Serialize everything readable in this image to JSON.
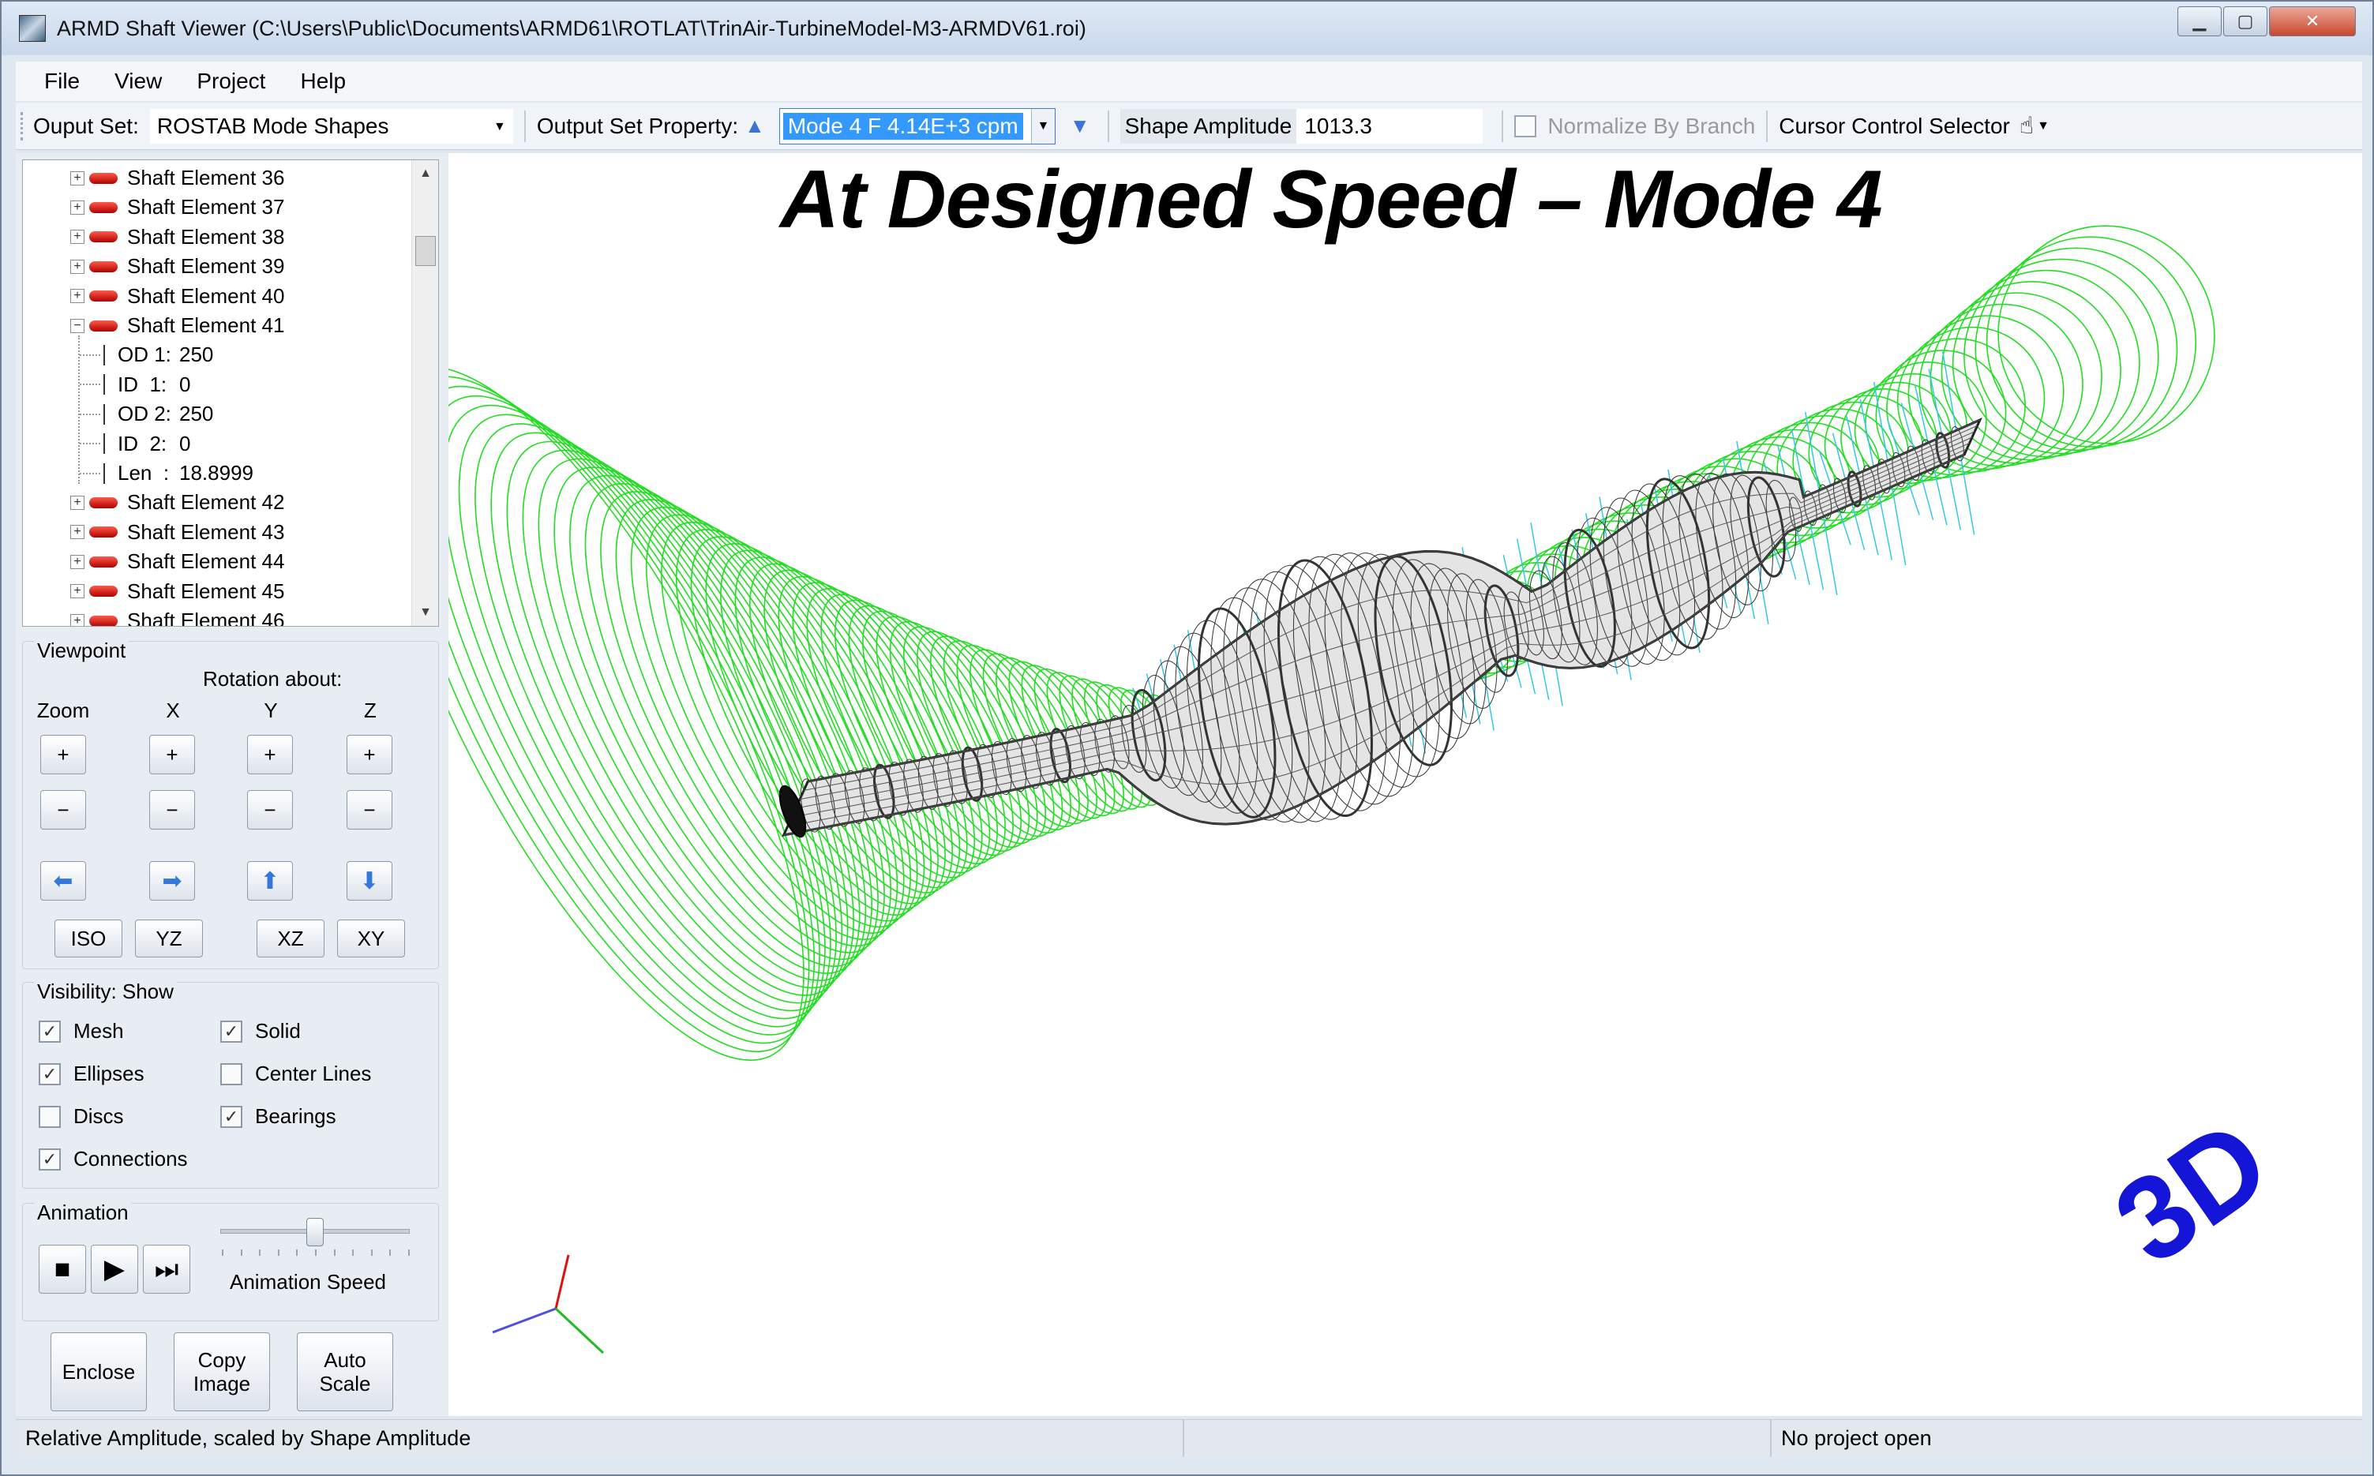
{
  "window": {
    "title": "ARMD Shaft Viewer (C:\\Users\\Public\\Documents\\ARMD61\\ROTLAT\\TrinAir-TurbineModel-M3-ARMDV61.roi)"
  },
  "menu": [
    "File",
    "View",
    "Project",
    "Help"
  ],
  "toolbar": {
    "output_set_label": "Ouput Set:",
    "output_set_value": "ROSTAB Mode Shapes",
    "property_label": "Output Set Property:",
    "property_value": "Mode 4 F 4.14E+3 cpm",
    "shape_amplitude_label": "Shape Amplitude",
    "shape_amplitude_value": "1013.3",
    "normalize_label": "Normalize By Branch",
    "cursor_label": "Cursor Control Selector"
  },
  "tree": {
    "elements_before": [
      "Shaft Element 36",
      "Shaft Element 37",
      "Shaft Element 38",
      "Shaft Element 39",
      "Shaft Element 40"
    ],
    "expanded": "Shaft Element 41",
    "properties": [
      {
        "name": "OD 1:",
        "value": "250"
      },
      {
        "name": "ID  1:",
        "value": "0"
      },
      {
        "name": "OD 2:",
        "value": "250"
      },
      {
        "name": "ID  2:",
        "value": "0"
      },
      {
        "name": "Len  :",
        "value": "18.8999"
      }
    ],
    "elements_after": [
      "Shaft Element 42",
      "Shaft Element 43",
      "Shaft Element 44",
      "Shaft Element 45",
      "Shaft Element 46"
    ]
  },
  "viewpoint": {
    "title": "Viewpoint",
    "rotation_label": "Rotation about:",
    "zoom": "Zoom",
    "x": "X",
    "y": "Y",
    "z": "Z",
    "plus": "+",
    "minus": "−",
    "views": [
      "ISO",
      "YZ",
      "XZ",
      "XY"
    ]
  },
  "visibility": {
    "title": "Visibility: Show",
    "items": [
      {
        "label": "Mesh",
        "checked": true
      },
      {
        "label": "Solid",
        "checked": true
      },
      {
        "label": "Ellipses",
        "checked": true
      },
      {
        "label": "Center Lines",
        "checked": false
      },
      {
        "label": "Discs",
        "checked": false
      },
      {
        "label": "Bearings",
        "checked": true
      },
      {
        "label": "Connections",
        "checked": true
      }
    ]
  },
  "animation": {
    "title": "Animation",
    "speed_label": "Animation Speed",
    "speed_fraction": 0.5
  },
  "buttons": {
    "enclose": "Enclose",
    "copy_image": "Copy\nImage",
    "auto_scale": "Auto\nScale"
  },
  "viewport": {
    "heading": "At Designed Speed – Mode 4",
    "badge": "3D"
  },
  "status": {
    "left": "Relative Amplitude, scaled by Shape Amplitude",
    "middle": "",
    "right": "No project open"
  },
  "colors": {
    "ellipse": "#22dd22",
    "bearing": "#33c8e8",
    "shaft": "#222222",
    "badge": "#1515d8",
    "selection": "#3399ff"
  }
}
